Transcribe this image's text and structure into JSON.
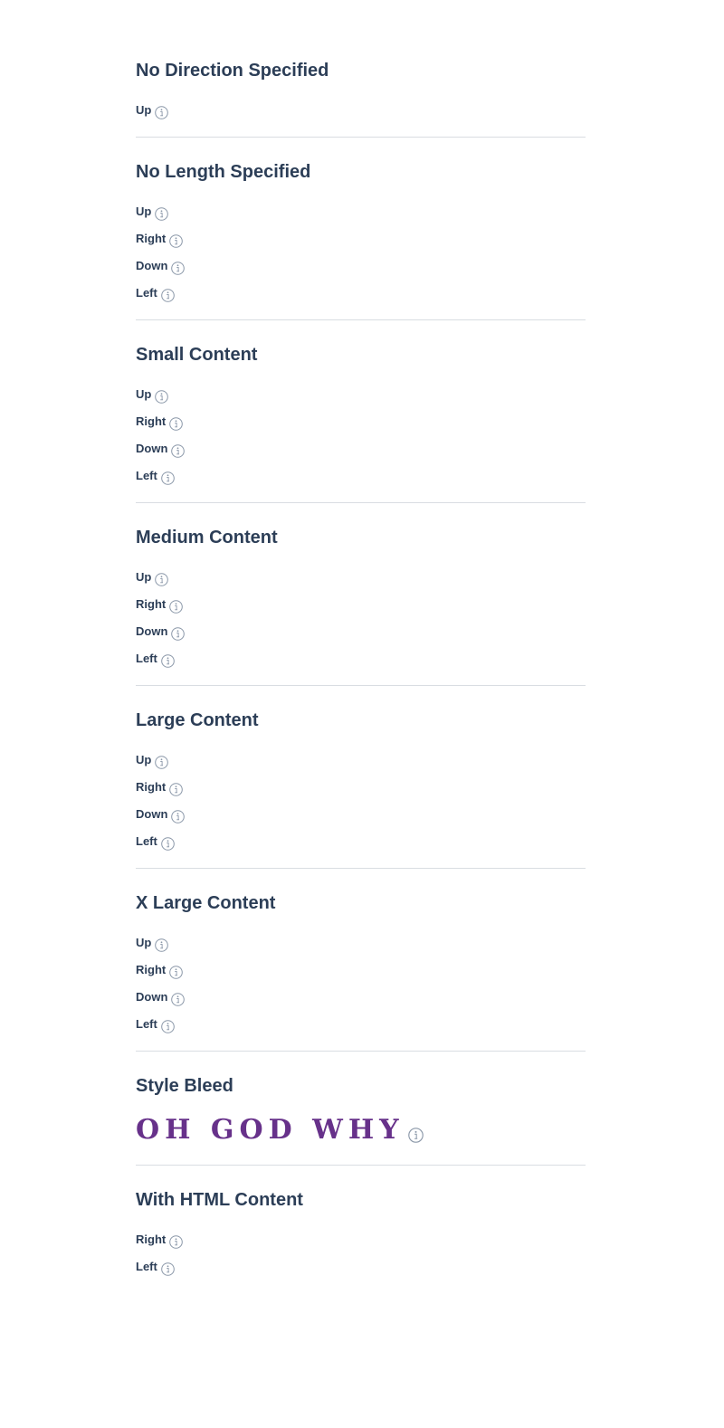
{
  "sections": [
    {
      "title": "No Direction Specified",
      "items": [
        "Up"
      ]
    },
    {
      "title": "No Length Specified",
      "items": [
        "Up",
        "Right",
        "Down",
        "Left"
      ]
    },
    {
      "title": "Small Content",
      "items": [
        "Up",
        "Right",
        "Down",
        "Left"
      ]
    },
    {
      "title": "Medium Content",
      "items": [
        "Up",
        "Right",
        "Down",
        "Left"
      ]
    },
    {
      "title": "Large Content",
      "items": [
        "Up",
        "Right",
        "Down",
        "Left"
      ]
    },
    {
      "title": "X Large Content",
      "items": [
        "Up",
        "Right",
        "Down",
        "Left"
      ]
    },
    {
      "title": "Style Bleed",
      "items": [
        "OH GOD WHY"
      ]
    },
    {
      "title": "With HTML Content",
      "items": [
        "Right",
        "Left"
      ]
    }
  ],
  "icons": {
    "tooltip_trigger": "info-circle-icon"
  },
  "colors": {
    "text": "#2c3e57",
    "divider": "#d9dde2",
    "icon_stroke": "#8a97a8",
    "style_bleed": "#67318a"
  }
}
